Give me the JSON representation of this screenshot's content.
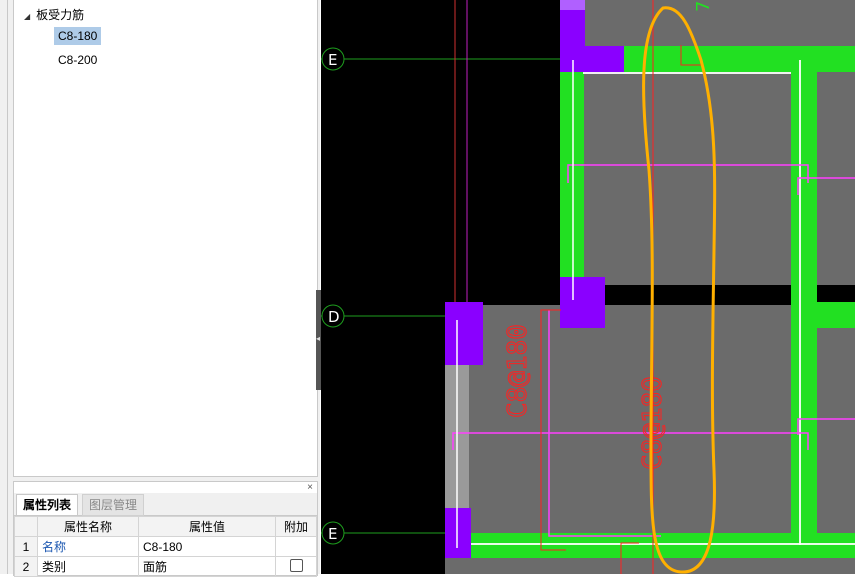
{
  "tree": {
    "root_label": "板受力筋",
    "items": [
      {
        "label": "C8-180",
        "selected": true
      },
      {
        "label": "C8-200",
        "selected": false
      }
    ]
  },
  "props_panel": {
    "close_glyph": "×",
    "tabs": [
      "属性列表",
      "图层管理"
    ],
    "columns": [
      "属性名称",
      "属性值",
      "附加"
    ],
    "rows": [
      {
        "index": "1",
        "name": "名称",
        "value": "C8-180",
        "has_checkbox": false
      },
      {
        "index": "2",
        "name": "类别",
        "value": "面筋",
        "has_checkbox": true
      }
    ]
  },
  "canvas": {
    "axis_labels": {
      "top": "E",
      "middle": "D",
      "bottom": "E"
    },
    "rebar_labels": [
      "C8@180",
      "C8@180"
    ],
    "top_green_text": "7",
    "colors": {
      "background": "#000000",
      "slab": "#6b6b6b",
      "beam": "#22e022",
      "column": "#8a00ff",
      "rebar": "#ff40ff",
      "axis_line": "#ff3030",
      "highlight": "#ffb000"
    }
  }
}
